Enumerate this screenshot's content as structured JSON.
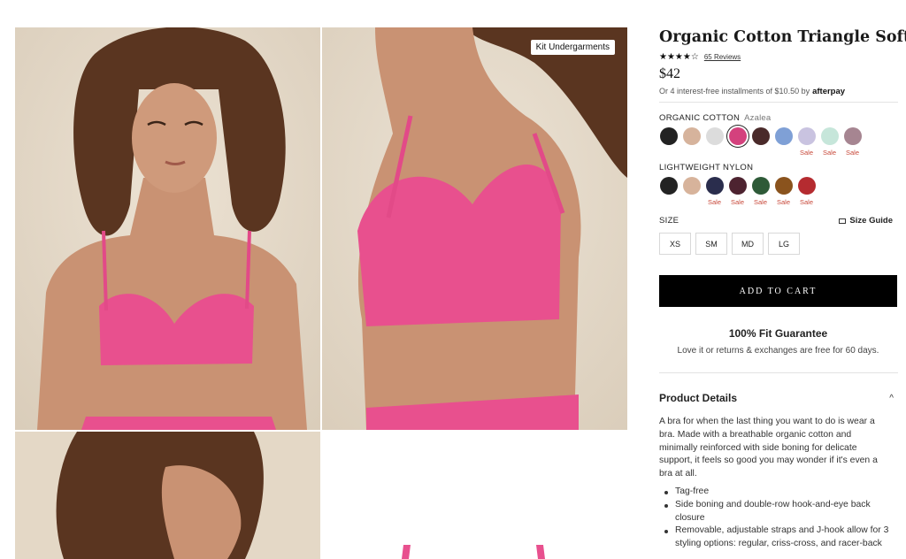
{
  "product": {
    "title": "Organic Cotton Triangle Soft Bra",
    "rating": {
      "stars": "★★★★☆",
      "value": 4.5,
      "reviews_label": "65 Reviews"
    },
    "price": "$42",
    "installments": {
      "text": "Or 4 interest-free installments of $10.50 by",
      "provider": "afterpay"
    }
  },
  "gallery": {
    "brand_tag": "Kit Undergarments",
    "images": [
      {
        "name": "front-view-photo",
        "alt": "model front view"
      },
      {
        "name": "side-view-photo",
        "alt": "model side view"
      },
      {
        "name": "profile-view-photo",
        "alt": "model profile view"
      },
      {
        "name": "back-view-photo",
        "alt": "model back view"
      }
    ]
  },
  "swatches": {
    "organic_cotton": {
      "label": "ORGANIC COTTON",
      "selected": "Azalea",
      "colors": [
        {
          "hex": "#222222",
          "sale": ""
        },
        {
          "hex": "#d6b39c",
          "sale": ""
        },
        {
          "hex": "#dcdcdc",
          "sale": ""
        },
        {
          "hex": "#d4417d",
          "sale": "",
          "selected": true
        },
        {
          "hex": "#4a2a2a",
          "sale": ""
        },
        {
          "hex": "#7fa0d6",
          "sale": ""
        },
        {
          "hex": "#c9c3e0",
          "sale": "Sale"
        },
        {
          "hex": "#c6e6da",
          "sale": "Sale"
        },
        {
          "hex": "#a68591",
          "sale": "Sale"
        }
      ]
    },
    "lightweight_nylon": {
      "label": "LIGHTWEIGHT NYLON",
      "colors": [
        {
          "hex": "#232323",
          "sale": ""
        },
        {
          "hex": "#d7b39b",
          "sale": ""
        },
        {
          "hex": "#2a2d4d",
          "sale": "Sale"
        },
        {
          "hex": "#4d2330",
          "sale": "Sale"
        },
        {
          "hex": "#2e5a38",
          "sale": "Sale"
        },
        {
          "hex": "#8a531d",
          "sale": "Sale"
        },
        {
          "hex": "#b52b30",
          "sale": "Sale"
        }
      ]
    }
  },
  "size": {
    "label": "SIZE",
    "guide_label": "Size Guide",
    "options": [
      "XS",
      "SM",
      "MD",
      "LG"
    ]
  },
  "cart": {
    "label": "ADD TO CART"
  },
  "guarantee": {
    "title": "100% Fit Guarantee",
    "subtitle": "Love it or returns & exchanges are free for 60 days."
  },
  "details": {
    "title": "Product Details",
    "chevron": "^",
    "description": "A bra for when the last thing you want to do is wear a bra. Made with a breathable organic cotton and minimally reinforced with side boning for delicate support, it feels so good you may wonder if it's even a bra at all.",
    "bullets": [
      "Tag-free",
      "Side boning and double-row hook-and-eye back closure",
      "Removable, adjustable straps and J-hook allow for 3 styling options: regular, criss-cross, and racer-back"
    ]
  },
  "colors": {
    "accent_black": "#000000",
    "sale_red": "#c8493a",
    "product_pink": "#e8508e"
  }
}
